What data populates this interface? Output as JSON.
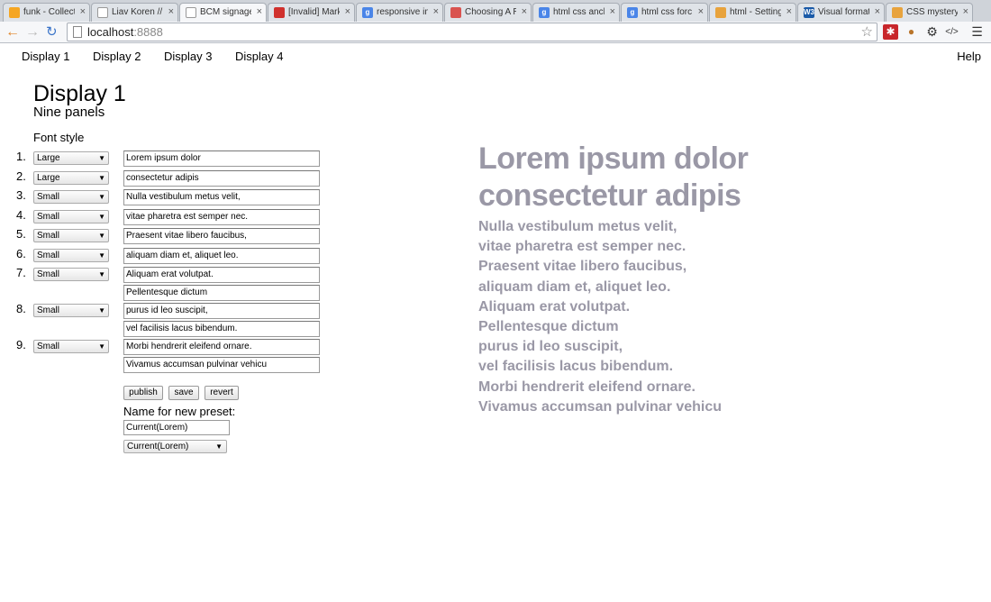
{
  "browser": {
    "tabs": [
      {
        "title": "funk - Collect",
        "icon": "orange-feed-icon",
        "color": "#f5a623",
        "glyph": ""
      },
      {
        "title": "Liav Koren //",
        "icon": "page-icon",
        "color": "#ffffff",
        "glyph": ""
      },
      {
        "title": "BCM signage",
        "icon": "page-icon",
        "color": "#ffffff",
        "glyph": ""
      },
      {
        "title": "[Invalid] Mark",
        "icon": "red-square-icon",
        "color": "#d0312d",
        "glyph": ""
      },
      {
        "title": "responsive im",
        "icon": "google-icon",
        "color": "#4a85e8",
        "glyph": "g"
      },
      {
        "title": "Choosing A R",
        "icon": "flag-icon",
        "color": "#d9534f",
        "glyph": ""
      },
      {
        "title": "html css anch",
        "icon": "google-icon",
        "color": "#4a85e8",
        "glyph": "g"
      },
      {
        "title": "html css forc",
        "icon": "google-icon",
        "color": "#4a85e8",
        "glyph": "g"
      },
      {
        "title": "html - Setting",
        "icon": "stack-icon",
        "color": "#e8a33d",
        "glyph": ""
      },
      {
        "title": "Visual format",
        "icon": "w3c-icon",
        "color": "#1a5aa8",
        "glyph": "W3"
      },
      {
        "title": "CSS mystery:",
        "icon": "stack-icon",
        "color": "#e8a33d",
        "glyph": ""
      }
    ],
    "url_host": "localhost",
    "url_port": ":8888"
  },
  "nav": {
    "links": [
      "Display 1",
      "Display 2",
      "Display 3",
      "Display 4"
    ],
    "help": "Help"
  },
  "page": {
    "title": "Display 1",
    "subtitle": "Nine panels",
    "font_style_label": "Font style"
  },
  "rows": [
    {
      "num": "1.",
      "style": "Large",
      "lines": [
        "Lorem ipsum dolor"
      ]
    },
    {
      "num": "2.",
      "style": "Large",
      "lines": [
        "consectetur adipis"
      ]
    },
    {
      "num": "3.",
      "style": "Small",
      "lines": [
        "Nulla vestibulum metus velit,"
      ]
    },
    {
      "num": "4.",
      "style": "Small",
      "lines": [
        "vitae pharetra est semper nec."
      ]
    },
    {
      "num": "5.",
      "style": "Small",
      "lines": [
        "Praesent vitae libero faucibus,"
      ]
    },
    {
      "num": "6.",
      "style": "Small",
      "lines": [
        "aliquam diam et, aliquet leo."
      ]
    },
    {
      "num": "7.",
      "style": "Small",
      "lines": [
        "Aliquam erat volutpat.",
        "Pellentesque dictum"
      ]
    },
    {
      "num": "8.",
      "style": "Small",
      "lines": [
        "purus id leo suscipit,",
        "vel facilisis lacus bibendum."
      ]
    },
    {
      "num": "9.",
      "style": "Small",
      "lines": [
        "Morbi hendrerit eleifend ornare.",
        "Vivamus accumsan pulvinar vehicu"
      ]
    }
  ],
  "buttons": {
    "publish": "publish",
    "save": "save",
    "revert": "revert"
  },
  "preset": {
    "label": "Name for new preset:",
    "value": "Current(Lorem)",
    "selected": "Current(Lorem)"
  },
  "preview": {
    "large_lines": [
      "Lorem ipsum dolor",
      "consectetur adipis"
    ],
    "small_lines": [
      "Nulla vestibulum metus velit,",
      "vitae pharetra est semper nec.",
      "Praesent vitae libero faucibus,",
      "aliquam diam et, aliquet leo.",
      "Aliquam erat volutpat.",
      "Pellentesque dictum",
      "purus id leo suscipit,",
      "vel facilisis lacus bibendum.",
      "Morbi hendrerit eleifend ornare.",
      "Vivamus accumsan pulvinar vehicu"
    ],
    "color": "#9a98a6"
  }
}
